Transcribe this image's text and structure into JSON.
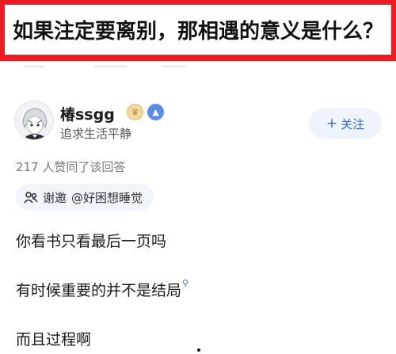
{
  "question": {
    "title": "如果注定要离别，那相遇的意义是什么？"
  },
  "author": {
    "name": "椿ssgg",
    "bio": "追求生活平静",
    "badges": [
      "crown-icon",
      "level-icon"
    ],
    "follow_label": "关注",
    "follow_plus": "+"
  },
  "answer": {
    "likes_text": "217 人赞同了该回答",
    "invite": {
      "label": "谢邀",
      "mention": "@好困想睡觉"
    },
    "paragraphs": [
      "你看书只看最后一页吗",
      "有时候重要的并不是",
      "而且过程啊"
    ],
    "search_term": "结局"
  },
  "colors": {
    "banner_border": "#ed1c24",
    "accent_blue": "#2f6cd8",
    "follow_bg": "#eef3fc",
    "chip_bg": "#f1f4fa"
  }
}
